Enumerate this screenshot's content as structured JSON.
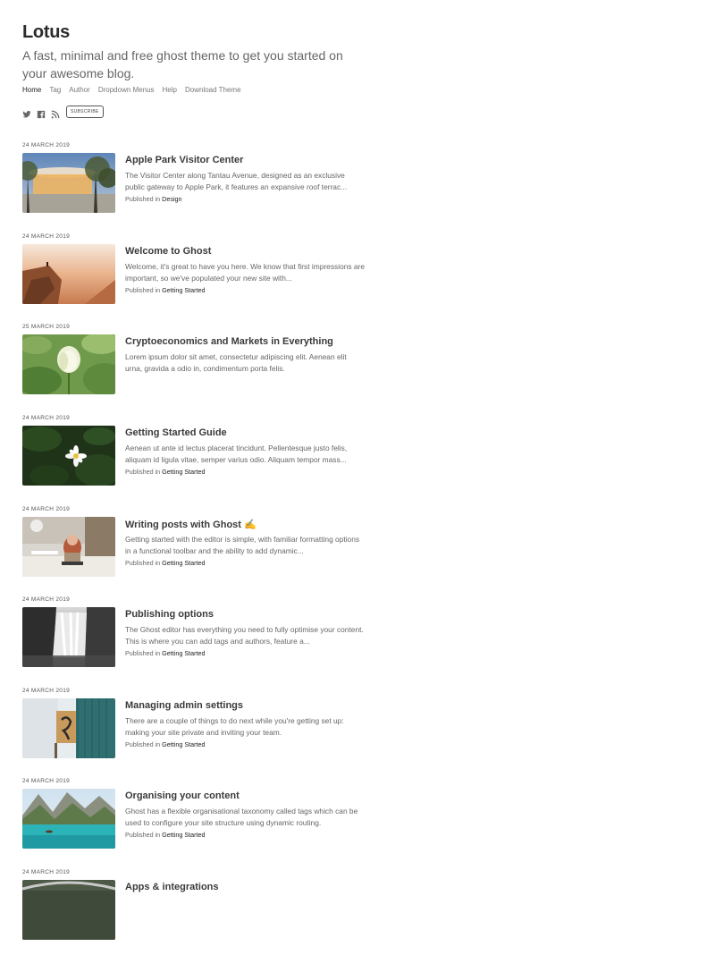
{
  "site": {
    "title": "Lotus",
    "description": "A fast, minimal and free ghost theme to get you started on your awesome blog."
  },
  "nav": {
    "items": [
      "Home",
      "Tag",
      "Author",
      "Dropdown Menus",
      "Help",
      "Download Theme"
    ],
    "active": "Home"
  },
  "social": {
    "icons": [
      "twitter-icon",
      "facebook-icon",
      "rss-icon"
    ],
    "subscribe_label": "SUBSCRIBE"
  },
  "meta_prefix": "Published in",
  "posts": [
    {
      "date": "24 MARCH 2019",
      "title": "Apple Park Visitor Center",
      "excerpt": "The Visitor Center along Tantau Avenue, designed as an exclusive public gateway to Apple Park, it features an expansive roof terrac...",
      "tag": "Design"
    },
    {
      "date": "24 MARCH 2019",
      "title": "Welcome to Ghost",
      "excerpt": "Welcome, it's great to have you here. We know that first impressions are important, so we've populated your new site with...",
      "tag": "Getting Started"
    },
    {
      "date": "25 MARCH 2019",
      "title": "Cryptoeconomics and Markets in Everything",
      "excerpt": "Lorem ipsum dolor sit amet, consectetur adipiscing elit. Aenean elit urna, gravida a odio in, condimentum porta felis.",
      "tag": ""
    },
    {
      "date": "24 MARCH 2019",
      "title": "Getting Started Guide",
      "excerpt": "Aenean ut ante id lectus placerat tincidunt. Pellentesque justo felis, aliquam id ligula vitae, semper varius odio. Aliquam tempor mass...",
      "tag": "Getting Started"
    },
    {
      "date": "24 MARCH 2019",
      "title": "Writing posts with Ghost ✍️",
      "excerpt": "Getting started with the editor is simple, with familiar formatting options in a functional toolbar and the ability to add dynamic...",
      "tag": "Getting Started"
    },
    {
      "date": "24 MARCH 2019",
      "title": "Publishing options",
      "excerpt": "The Ghost editor has everything you need to fully optimise your content. This is where you can add tags and authors, feature a...",
      "tag": "Getting Started"
    },
    {
      "date": "24 MARCH 2019",
      "title": "Managing admin settings",
      "excerpt": "There are a couple of things to do next while you're getting set up: making your site private and inviting your team.",
      "tag": "Getting Started"
    },
    {
      "date": "24 MARCH 2019",
      "title": "Organising your content",
      "excerpt": "Ghost has a flexible organisational taxonomy called tags which can be used to configure your site structure using dynamic routing.",
      "tag": "Getting Started"
    },
    {
      "date": "24 MARCH 2019",
      "title": "Apps & integrations",
      "excerpt": "",
      "tag": ""
    }
  ]
}
